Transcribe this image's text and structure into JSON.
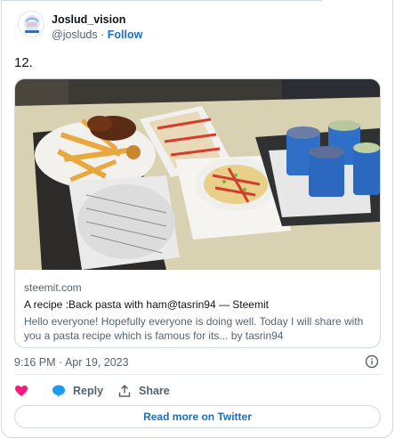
{
  "author": {
    "name": "Joslud_vision",
    "handle": "@josluds",
    "separator": "·",
    "follow_label": "Follow"
  },
  "tweet": {
    "text": "12."
  },
  "link_card": {
    "domain": "steemit.com",
    "title": "A recipe :Back pasta with ham@tasrin94 — Steemit",
    "description": "Hello everyone! Hopefully everyone is doing well. Today I will share with you a pasta recipe which is famous for its... by tasrin94"
  },
  "meta": {
    "timestamp": "9:16 PM · Apr 19, 2023"
  },
  "actions": {
    "like_label": "",
    "reply_label": "Reply",
    "share_label": "Share"
  },
  "read_more_label": "Read more on Twitter",
  "colors": {
    "link_blue": "#1d6fb8",
    "like_red": "#f91880",
    "reply_blue": "#1d9bf0",
    "muted_text": "#536471",
    "border": "#cfd9de"
  },
  "icons": {
    "like": "heart-icon",
    "reply": "speech-bubble-icon",
    "share": "upload-arrow-icon",
    "info": "info-circle-icon"
  }
}
